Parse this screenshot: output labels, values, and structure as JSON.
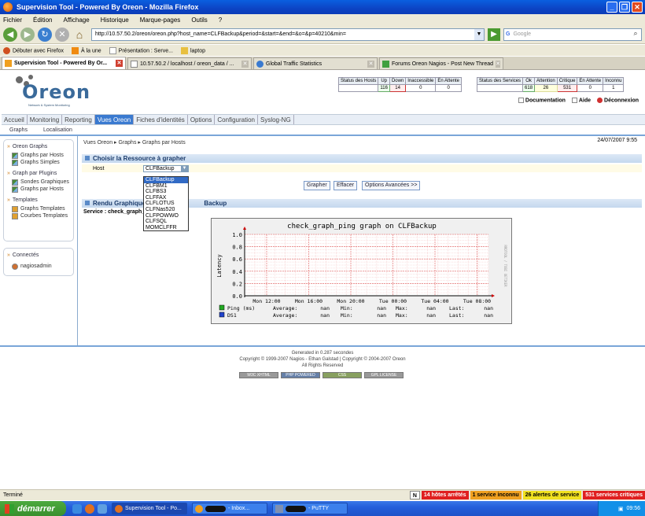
{
  "window": {
    "title": "Supervision Tool - Powered By Oreon - Mozilla Firefox",
    "buttons": [
      "_",
      "❐",
      "✕"
    ]
  },
  "menu": [
    "Fichier",
    "Édition",
    "Affichage",
    "Historique",
    "Marque-pages",
    "Outils",
    "?"
  ],
  "navbar": {
    "url": "http://10.57.50.2/oreon/oreon.php?host_name=CLFBackup&period=&start=&end=&o=&p=40210&min=",
    "search_placeholder": "Google"
  },
  "bookmarks": [
    "Débuter avec Firefox",
    "À la une",
    "Présentation : Serve...",
    "laptop"
  ],
  "tabs": [
    {
      "label": "Supervision Tool - Powered By Or...",
      "active": true
    },
    {
      "label": "10.57.50.2 / localhost / oreon_data / ...",
      "active": false
    },
    {
      "label": "Global Traffic Statistics",
      "active": false
    },
    {
      "label": "Forums Oreon Nagios - Post New Thread",
      "active": false
    }
  ],
  "logo": {
    "word": "Oreon",
    "sub": "Network & System Monitoring"
  },
  "host_status": {
    "headers": [
      "Status des Hosts",
      "Up",
      "Down",
      "Inaccessible",
      "En Attente"
    ],
    "values": [
      "116",
      "14",
      "0",
      "0"
    ]
  },
  "service_status": {
    "headers": [
      "Status des Services",
      "Ok",
      "Attention",
      "Critique",
      "En Attente",
      "Inconnu"
    ],
    "values": [
      "618",
      "26",
      "531",
      "0",
      "1"
    ]
  },
  "toplinks": {
    "doc": "Documentation",
    "help": "Aide",
    "logout": "Déconnexion"
  },
  "mainnav": [
    "Accueil",
    "Monitoring",
    "Reporting",
    "Vues Oreon",
    "Fiches d'identités",
    "Options",
    "Configuration",
    "Syslog-NG"
  ],
  "subnav": [
    "Graphs",
    "Localisation"
  ],
  "sidebar": {
    "graphs_title": "Oreon Graphs",
    "graphs_items": [
      "Graphs par Hosts",
      "Graphs Simples"
    ],
    "plugin_title": "Graph par Plugins",
    "plugin_items": [
      "Sondes Graphiques",
      "Graphs par Hosts"
    ],
    "templates_title": "Templates",
    "templates_items": [
      "Graphs Templates",
      "Courbes Templates"
    ],
    "connected_title": "Connectés",
    "connected_user": "nagiosadmin"
  },
  "breadcrumb": "Vues Oreon ▸ Graphs ▸ Graphs par Hosts",
  "date": "24/07/2007 9:55",
  "choose_section": {
    "title": "Choisir la Ressource à grapher",
    "host_label": "Host",
    "selected": "CLFBackup"
  },
  "dropdown_options": [
    "CLFBackup",
    "CLFBM1",
    "CLFBS3",
    "CLFFAX",
    "CLFLOTUS",
    "CLFNas520",
    "CLFPOWWO",
    "CLFSQL",
    "MOMCLFFR"
  ],
  "buttons": {
    "graph": "Grapher",
    "clear": "Effacer",
    "advanced": "Options Avancées >>"
  },
  "render_section": {
    "title": "Rendu Graphique : CLFBackup",
    "title_hidden": "Rendu Graphique",
    "title_tail": "Backup",
    "service": "Service : check_graph_p"
  },
  "chart_data": {
    "type": "line",
    "title": "check_graph_ping graph on CLFBackup",
    "ylabel": "Latency",
    "side_label": "RRDTOOL / TOBI OETIKER",
    "yticks": [
      "1.0",
      "0.8",
      "0.6",
      "0.4",
      "0.2",
      "0.0"
    ],
    "ylim": [
      0,
      1
    ],
    "xticks": [
      "Mon 12:00",
      "Mon 16:00",
      "Mon 20:00",
      "Tue 00:00",
      "Tue 04:00",
      "Tue 08:00"
    ],
    "series": [
      {
        "name": "Ping (ms)",
        "color": "#22aa22",
        "values": []
      },
      {
        "name": "DS1",
        "color": "#2244cc",
        "values": []
      }
    ],
    "legend_rows": [
      {
        "name": "Ping (ms)",
        "avg_label": "Average:",
        "avg": "nan",
        "min_label": "Min:",
        "min": "nan",
        "max_label": "Max:",
        "max": "nan",
        "last_label": "Last:",
        "last": "nan"
      },
      {
        "name": "DS1",
        "avg_label": "Average:",
        "avg": "nan",
        "min_label": "Min:",
        "min": "nan",
        "max_label": "Max:",
        "max": "nan",
        "last_label": "Last:",
        "last": "nan"
      }
    ]
  },
  "footer": {
    "line1": "Generated in 0.287 secondes",
    "line2": "Copyright © 1999-2007 Nagios - Ethan Galstad | Copyright © 2004-2007 Oreon",
    "line3": "All Rights Reserved",
    "badges": [
      "W3C XHTML",
      "PHP POWERED",
      "CSS",
      "GPL LICENSE"
    ]
  },
  "statusbar": {
    "left": "Terminé",
    "n_icon": "N",
    "hosts_down": "14 hôtes arrêtés",
    "svc_unknown": "1 service inconnu",
    "svc_warn": "26 alertes de service",
    "svc_crit": "531 services critiques"
  },
  "taskbar": {
    "start": "démarrer",
    "tasks": [
      "Supervision Tool - Po...",
      " - Inbox...",
      " - PuTTY"
    ],
    "clock": "09:56"
  }
}
